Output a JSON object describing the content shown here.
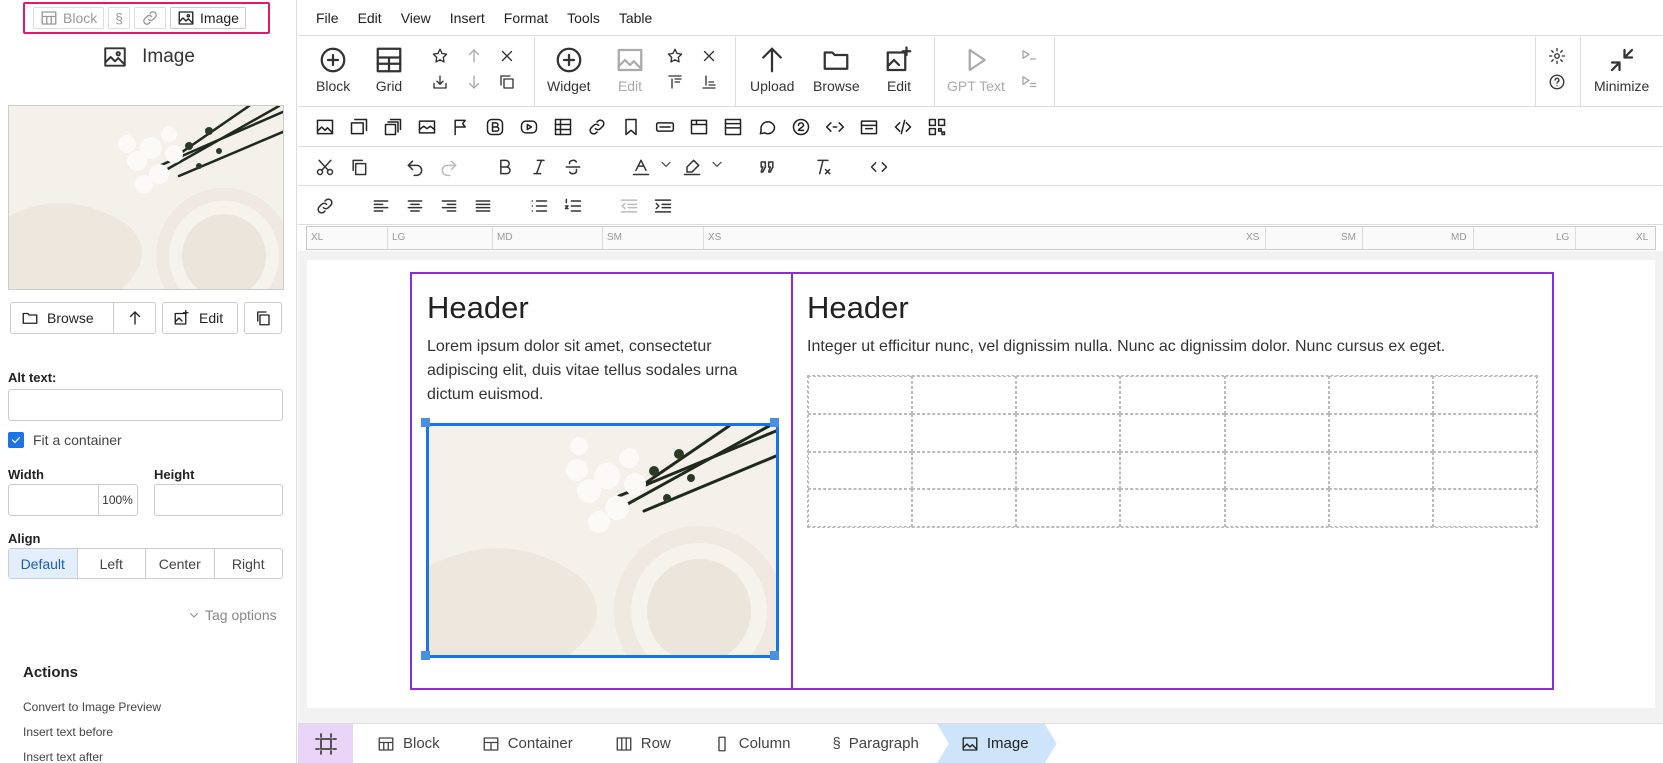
{
  "crumb": {
    "block": "Block",
    "paragraph_sym": "§",
    "image": "Image"
  },
  "panel": {
    "title": "Image"
  },
  "buttons": {
    "browse": "Browse",
    "edit": "Edit"
  },
  "fields": {
    "alt_text_label": "Alt text:",
    "alt_text_value": "",
    "fit_label": "Fit a container",
    "fit_checked": true,
    "width_label": "Width",
    "width_value": "",
    "width_unit": "100%",
    "height_label": "Height",
    "height_value": ""
  },
  "align": {
    "label": "Align",
    "options": [
      "Default",
      "Left",
      "Center",
      "Right"
    ],
    "selected": "Default"
  },
  "tag_options": "Tag options",
  "actions": {
    "title": "Actions",
    "items": [
      "Convert to Image Preview",
      "Insert text before",
      "Insert text after"
    ]
  },
  "menu": [
    "File",
    "Edit",
    "View",
    "Insert",
    "Format",
    "Tools",
    "Table"
  ],
  "toolbar": {
    "block": "Block",
    "grid": "Grid",
    "widget": "Widget",
    "edit_disabled": "Edit",
    "upload": "Upload",
    "browse": "Browse",
    "edit": "Edit",
    "gpt_text": "GPT Text",
    "minimize": "Minimize"
  },
  "ruler": {
    "left": [
      "XL",
      "LG",
      "MD",
      "SM",
      "XS"
    ],
    "right": [
      "XS",
      "SM",
      "MD",
      "LG",
      "XL"
    ]
  },
  "content": {
    "col1": {
      "header": "Header",
      "text": "Lorem ipsum dolor sit amet, consectetur adipiscing elit, duis vitae tellus sodales urna dictum euismod."
    },
    "col2": {
      "header": "Header",
      "text": "Integer ut efficitur nunc, vel dignissim nulla. Nunc ac dignissim dolor. Nunc cursus ex eget."
    }
  },
  "statusbar": {
    "items": [
      "Block",
      "Container",
      "Row",
      "Column",
      "Paragraph",
      "Image"
    ],
    "active": "Image"
  },
  "colors": {
    "accent": "#1a73e8",
    "row_outline": "#8a2be2",
    "crumb_outline": "#e0196e"
  }
}
